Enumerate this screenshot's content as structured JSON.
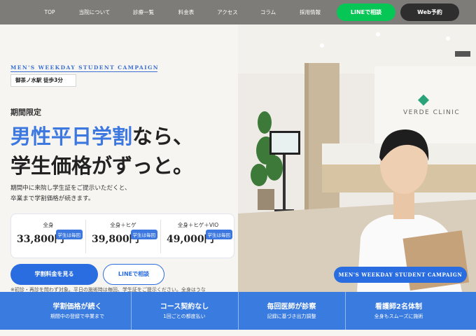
{
  "nav": {
    "items": [
      "TOP",
      "当院について",
      "診療一覧",
      "料金表",
      "アクセス",
      "コラム",
      "採用情報"
    ],
    "line_button": "LINEで相談",
    "web_button": "Web予約"
  },
  "hero": {
    "campaign_label": "MEN'S WEEKDAY STUDENT CAMPAIGN",
    "station": "御茶ノ水駅 徒歩3分",
    "period": "期間限定",
    "headline_blue": "男性平日学割",
    "headline_rest": "なら、",
    "headline_line2": "学生価格がずっと。",
    "desc_line1": "期間中に来院し学生証をご提示いただくと、",
    "desc_line2": "卒業まで学割価格が続きます。",
    "prices": [
      {
        "name": "全身",
        "value": "33,800円",
        "tag": "学生は毎回"
      },
      {
        "name": "全身＋ヒゲ",
        "value": "39,800円",
        "tag": "学生は毎回"
      },
      {
        "name": "全身＋ヒゲ＋VIO",
        "value": "49,000円",
        "tag": "学生は毎回"
      }
    ],
    "primary_button": "学割料金を見る",
    "secondary_button": "LINEで相談",
    "note": "※初診・再診を問わず対象。平日の施術時は毎回、学生証をご提示ください。全身はうな",
    "photo_badge": "MEN'S WEEKDAY STUDENT CAMPAIGN",
    "clinic_sign": "VERDE CLINIC"
  },
  "features": [
    {
      "title": "学割価格が続く",
      "sub": "期間中の登録で卒業まで"
    },
    {
      "title": "コース契約なし",
      "sub": "1回ごとの都度払い"
    },
    {
      "title": "毎回医師が診察",
      "sub": "記録に基づき出力調整"
    },
    {
      "title": "看護師2名体制",
      "sub": "全身もスムーズに施術"
    }
  ],
  "colors": {
    "accent": "#3a7be0",
    "line_green": "#06c755",
    "nav_bg": "#7e7c78"
  }
}
